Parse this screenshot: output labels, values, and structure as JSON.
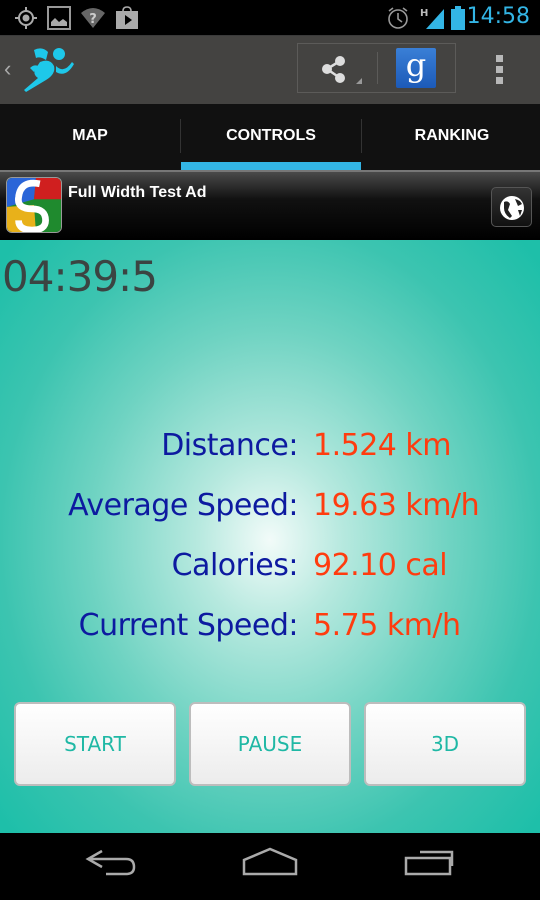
{
  "status_bar": {
    "left_icons": [
      "gps-icon",
      "gallery-icon",
      "wifi-unknown-icon",
      "play-store-icon"
    ],
    "right_icons": [
      "alarm-icon",
      "signal-h-icon",
      "battery-icon"
    ],
    "network_type": "H",
    "time": "14:58"
  },
  "action_bar": {
    "app_icon": "runner-icon",
    "actions": [
      "share-icon",
      "google-icon",
      "overflow-menu-icon"
    ],
    "google_glyph": "g"
  },
  "tabs": [
    {
      "label": "MAP",
      "selected": false
    },
    {
      "label": "CONTROLS",
      "selected": true
    },
    {
      "label": "RANKING",
      "selected": false
    }
  ],
  "ad": {
    "title": "Full Width Test Ad",
    "icon": "google-logo-icon",
    "action_icon": "globe-icon"
  },
  "main": {
    "timer": "04:39:5",
    "stats": [
      {
        "label": "Distance:",
        "value": "1.524 km"
      },
      {
        "label": "Average Speed:",
        "value": "19.63 km/h"
      },
      {
        "label": "Calories:",
        "value": "92.10 cal"
      },
      {
        "label": "Current Speed:",
        "value": "5.75 km/h"
      }
    ],
    "buttons": [
      {
        "label": "START"
      },
      {
        "label": "PAUSE"
      },
      {
        "label": "3D"
      }
    ]
  },
  "nav_bar": {
    "buttons": [
      "back-icon",
      "home-icon",
      "recent-apps-icon"
    ]
  },
  "colors": {
    "accent": "#33b5e5",
    "label": "#0d1aa0",
    "value": "#ff3c0f",
    "button_text": "#1fb8a5",
    "background": "#1ebfa9"
  }
}
